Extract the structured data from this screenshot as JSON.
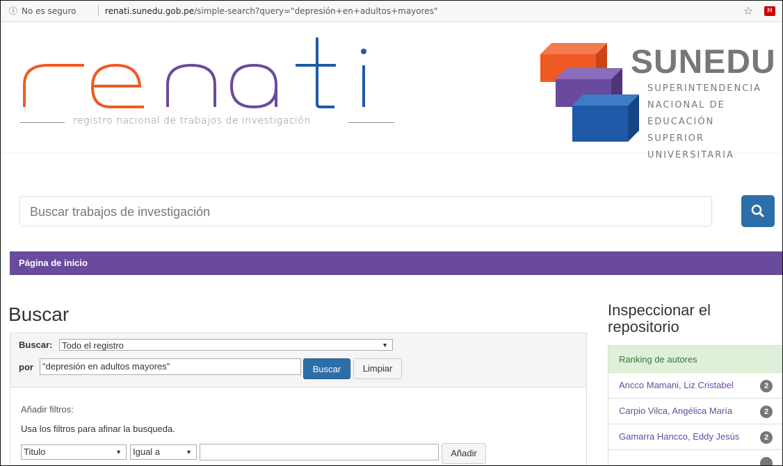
{
  "browser": {
    "security_text": "No es seguro",
    "url_host": "renati.sunedu.gob.pe",
    "url_path": "/simple-search?query=\"depresión+en+adultos+mayores\""
  },
  "header": {
    "renati_logo_text": "renati",
    "renati_tagline": "registro nacional de trabajos de investigación",
    "sunedu_word": "SUNEDU",
    "sunedu_lines": [
      "SUPERINTENDENCIA",
      "NACIONAL DE EDUCACIÓN",
      "SUPERIOR UNIVERSITARIA"
    ],
    "colors": {
      "orange": "#ef5a24",
      "purple": "#6a4a9c",
      "blue": "#1e5aa8"
    }
  },
  "search": {
    "placeholder": "Buscar trabajos de investigación"
  },
  "navbar": {
    "home_label": "Página de inicio"
  },
  "main": {
    "title": "Buscar",
    "scope_label": "Buscar:",
    "scope_value": "Todo el registro",
    "por_label": "por",
    "query_value": "\"depresión en adultos mayores\"",
    "buscar_button": "Buscar",
    "limpiar_button": "Limpiar",
    "filters_title": "Añadir filtros:",
    "filters_hint": "Usa los filtros para afinar la busqueda.",
    "filter_field": "Titulo",
    "filter_op": "Igual a",
    "anadir_button": "Añadir"
  },
  "sidebar": {
    "title": "Inspeccionar el repositorio",
    "ranking_header": "Ranking de autores",
    "authors": [
      {
        "name": "Ancco Mamani, Liz Cristabel",
        "count": "2"
      },
      {
        "name": "Carpio Vilca, Angélica María",
        "count": "2"
      },
      {
        "name": "Gamarra Hancco, Eddy Jesús",
        "count": "2"
      }
    ]
  }
}
